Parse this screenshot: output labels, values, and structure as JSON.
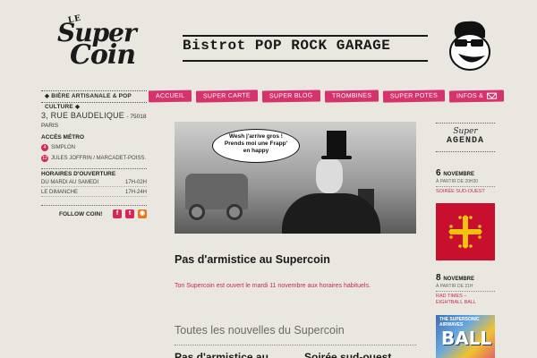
{
  "logo": {
    "le": "LE",
    "super": "Super",
    "coin": "Coin"
  },
  "tagline": "Bistrot POP ROCK GARAGE",
  "left": {
    "ribbon": "◆ Bière artisanale & pop culture ◆",
    "address": "3, RUE BAUDELIQUE",
    "city": "- 75018 PARIS",
    "metro_title": "Accès métro",
    "metro": [
      {
        "line": "4",
        "name": "Simplon"
      },
      {
        "line": "12",
        "name": "Jules Joffrin / Marcadet-Poiss."
      }
    ],
    "hours_title": "Horaires d'ouverture",
    "hours": [
      {
        "days": "Du mardi au samedi",
        "time": "17H-02H"
      },
      {
        "days": "Le dimanche",
        "time": "17H-24H"
      }
    ],
    "follow": "Follow coin!"
  },
  "nav": [
    "Accueil",
    "Super carte",
    "Super blog",
    "Trombines",
    "Super potes",
    "Infos &"
  ],
  "photo": {
    "bubble": [
      "Wesh j'arrive gros !",
      "Prends moi une Frapp'",
      "en happy"
    ]
  },
  "article": {
    "title": "Pas d'armistice au Supercoin",
    "text": "Ton Supercoin est ouvert le mardi 11 novembre aux horaires habituels."
  },
  "news": {
    "title": "Toutes les nouvelles du Supercoin",
    "item1": "Pas d'armistice au",
    "item2": "Soirée sud-ouest"
  },
  "agenda": {
    "super": "Super",
    "title": "AGENDA",
    "events": [
      {
        "day": "6",
        "month": "Novembre",
        "time": "à partir de 20h30",
        "name": "Soirée Sud-Ouest"
      },
      {
        "day": "8",
        "month": "Novembre",
        "time": "à partir de 21h",
        "name": "Rad Times – Eightball Ball"
      }
    ],
    "poster_top": "The Supersonic Airwaves",
    "poster_big": "BALL"
  },
  "colors": {
    "accent": "#d4336c",
    "bg": "#e9e7e0"
  }
}
